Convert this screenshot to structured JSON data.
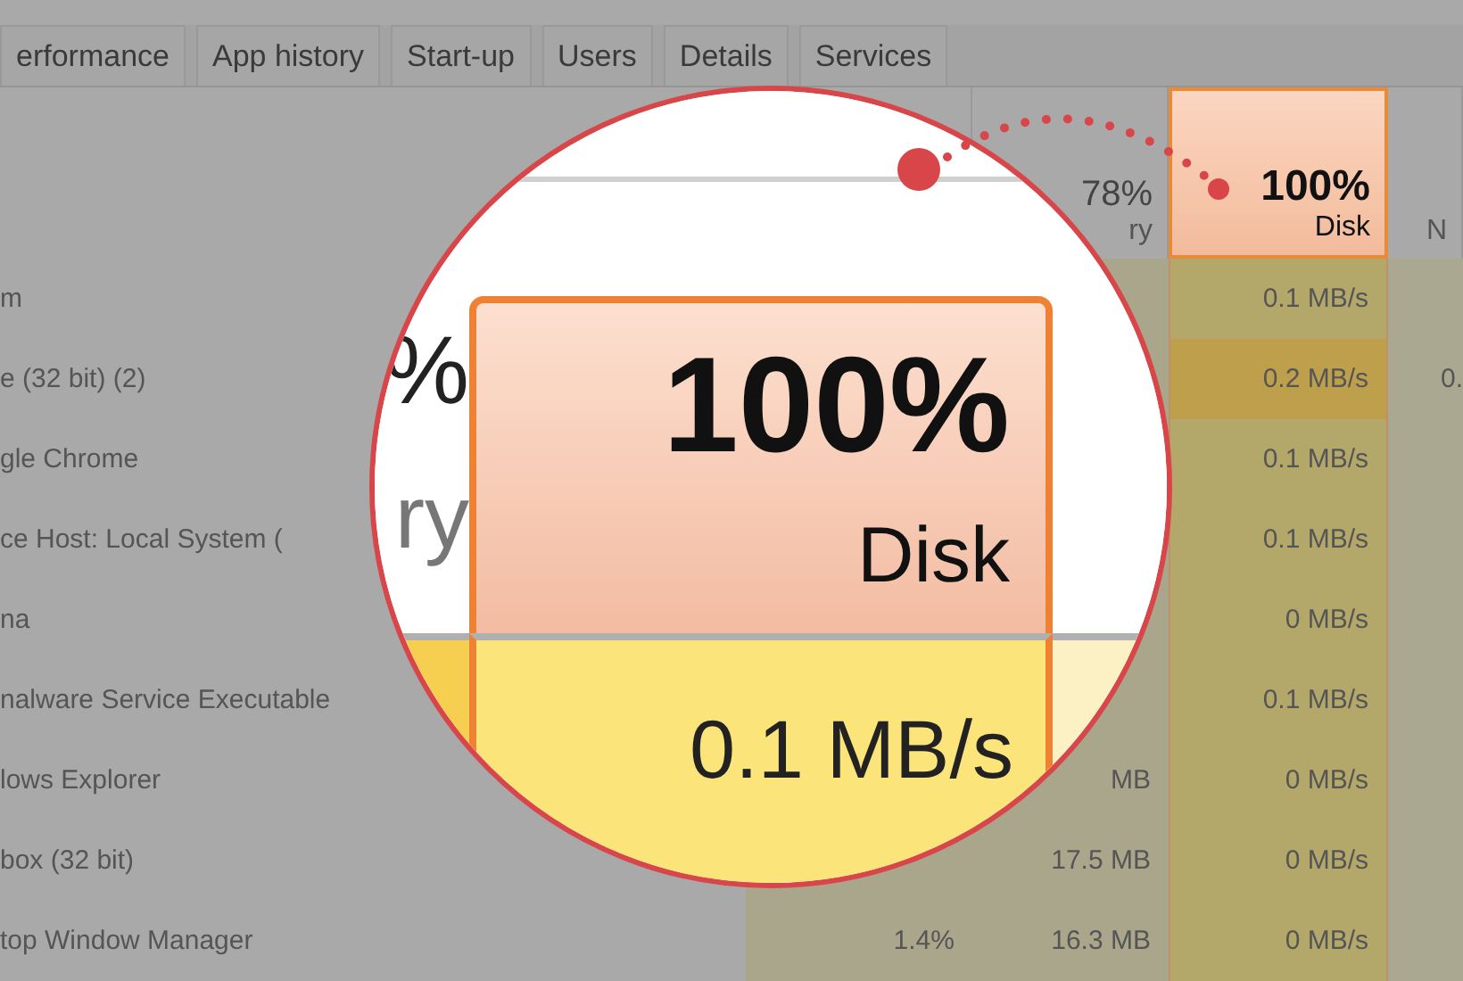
{
  "tabs": [
    {
      "label": "erformance",
      "selected": false
    },
    {
      "label": "App history",
      "selected": false
    },
    {
      "label": "Start-up",
      "selected": false
    },
    {
      "label": "Users",
      "selected": false
    },
    {
      "label": "Details",
      "selected": false
    },
    {
      "label": "Services",
      "selected": false
    }
  ],
  "table": {
    "headers": [
      {
        "kind": "blank"
      },
      {
        "kind": "blank"
      },
      {
        "kind": "metric",
        "percent": "78%",
        "label": "ry",
        "highlighted": false
      },
      {
        "kind": "metric",
        "percent": "100%",
        "label": "Disk",
        "highlighted": true
      },
      {
        "kind": "metric",
        "label": "N",
        "highlighted": false
      }
    ],
    "rows": [
      {
        "name": "m",
        "disk": "0.1 MB/s",
        "disk_hot": false
      },
      {
        "name": "e (32 bit) (2)",
        "disk": "0.2 MB/s",
        "disk_hot": true,
        "network": "0."
      },
      {
        "name": "gle Chrome",
        "disk": "0.1 MB/s",
        "disk_hot": false
      },
      {
        "name": "ce Host: Local System (",
        "disk": "0.1 MB/s",
        "disk_hot": false
      },
      {
        "name": "na",
        "disk": "0 MB/s",
        "disk_hot": false
      },
      {
        "name": "nalware Service Executable",
        "disk": "0.1 MB/s",
        "disk_hot": false
      },
      {
        "name": "lows Explorer",
        "memory": "MB",
        "disk": "0 MB/s",
        "disk_hot": false
      },
      {
        "name": "box (32 bit)",
        "memory": "17.5 MB",
        "disk": "0 MB/s",
        "disk_hot": false
      },
      {
        "name": "top Window Manager",
        "cpu": "1.4%",
        "memory": "16.3 MB",
        "disk": "0 MB/s",
        "disk_hot": false
      }
    ]
  },
  "magnifier": {
    "memory_percent_fragment": "%",
    "memory_label_fragment": "ry",
    "disk_percent": "100%",
    "disk_label": "Disk",
    "disk_value": "0.1 MB/s"
  }
}
